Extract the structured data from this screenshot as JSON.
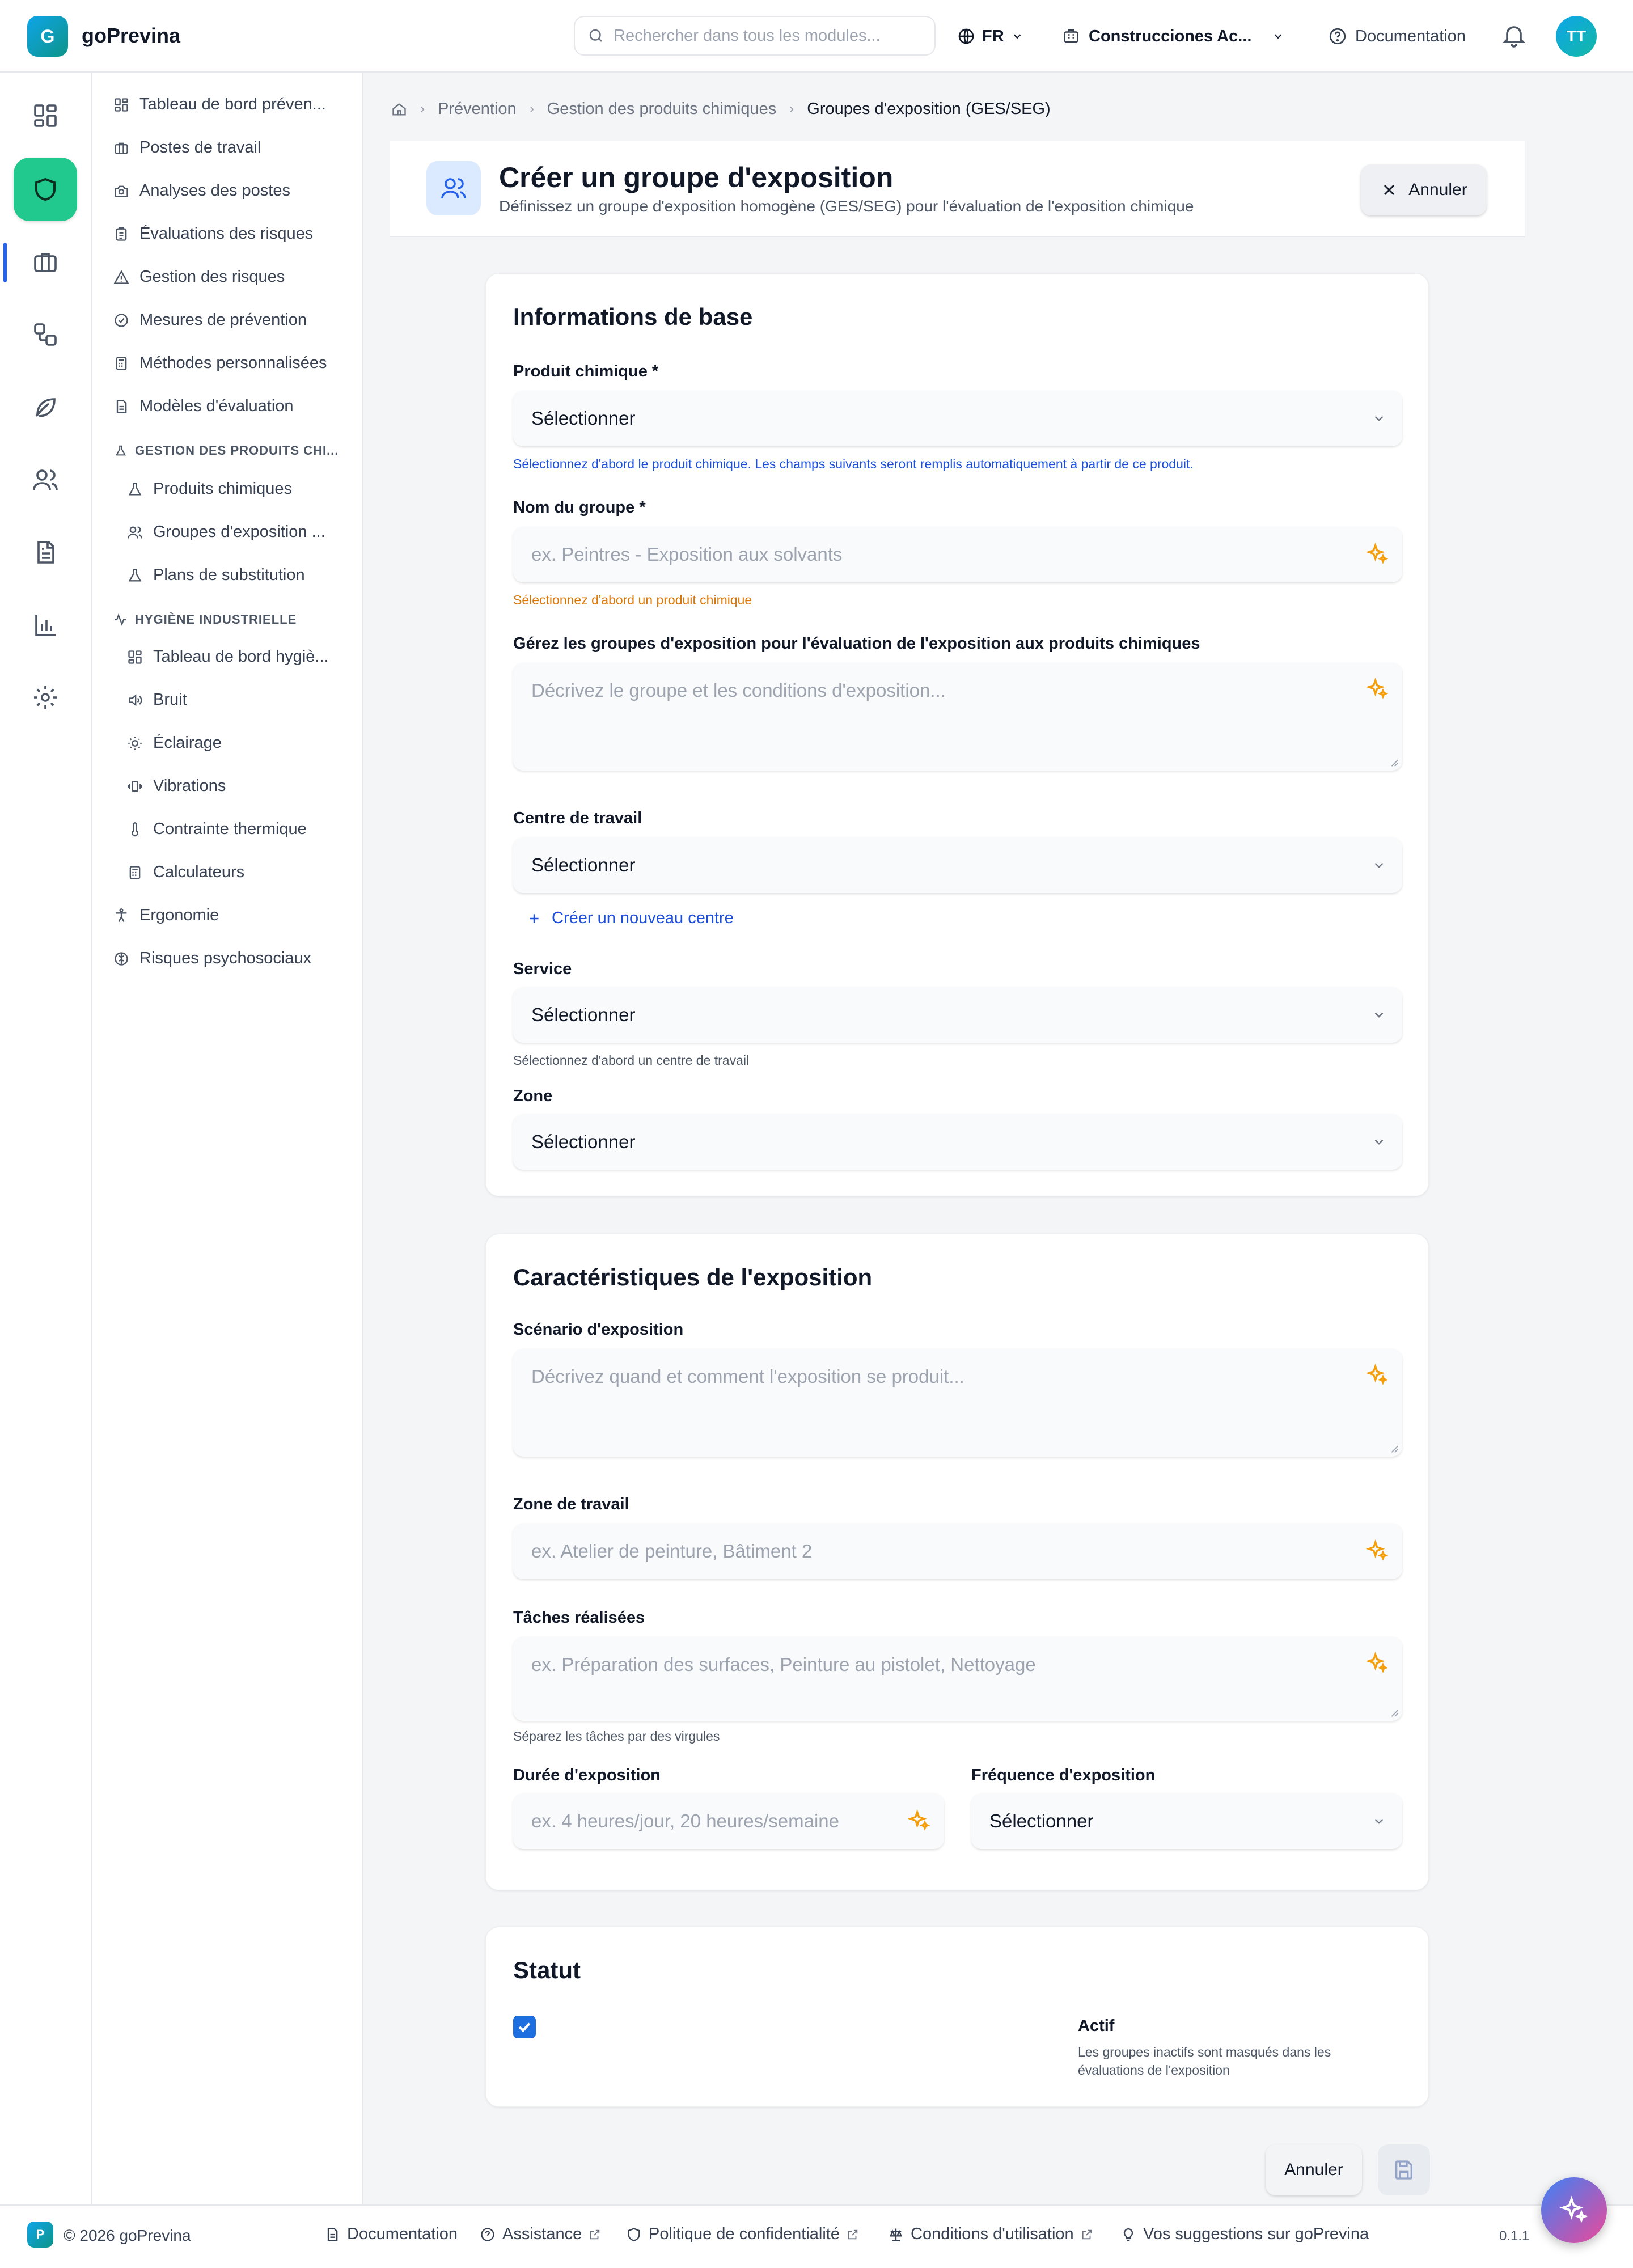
{
  "app": {
    "logo_letter": "G",
    "name": "goPrevina"
  },
  "topbar": {
    "search_placeholder": "Rechercher dans tous les modules...",
    "language": "FR",
    "company": "Construcciones Ac...",
    "documentation": "Documentation",
    "avatar_initials": "TT"
  },
  "rail": {
    "items": [
      {
        "icon": "dashboard-icon"
      },
      {
        "icon": "shield-icon",
        "active": true
      },
      {
        "icon": "briefcase-icon"
      },
      {
        "icon": "workflow-icon"
      },
      {
        "icon": "leaf-icon"
      },
      {
        "icon": "users-icon"
      },
      {
        "icon": "document-icon"
      },
      {
        "icon": "bar-chart-icon"
      },
      {
        "icon": "settings-icon"
      }
    ]
  },
  "sidenav": {
    "items": [
      {
        "label": "Tableau de bord préven...",
        "icon": "dashboard-icon"
      },
      {
        "label": "Postes de travail",
        "icon": "briefcase-icon"
      },
      {
        "label": "Analyses des postes",
        "icon": "camera-icon"
      },
      {
        "label": "Évaluations des risques",
        "icon": "clipboard-icon"
      },
      {
        "label": "Gestion des risques",
        "icon": "warning-icon"
      },
      {
        "label": "Mesures de prévention",
        "icon": "check-circle-icon"
      },
      {
        "label": "Méthodes personnalisées",
        "icon": "calculator-icon"
      },
      {
        "label": "Modèles d'évaluation",
        "icon": "file-icon"
      }
    ],
    "section_chem": {
      "title": "Gestion des produits chi...",
      "items": [
        {
          "label": "Produits chimiques",
          "icon": "flask-icon"
        },
        {
          "label": "Groupes d'exposition ...",
          "icon": "users-icon"
        },
        {
          "label": "Plans de substitution",
          "icon": "flask-icon"
        }
      ]
    },
    "section_hyg": {
      "title": "Hygiène industrielle",
      "items": [
        {
          "label": "Tableau de bord hygiè...",
          "icon": "dashboard-icon"
        },
        {
          "label": "Bruit",
          "icon": "speaker-icon"
        },
        {
          "label": "Éclairage",
          "icon": "sun-icon"
        },
        {
          "label": "Vibrations",
          "icon": "vibration-icon"
        },
        {
          "label": "Contrainte thermique",
          "icon": "thermometer-icon"
        },
        {
          "label": "Calculateurs",
          "icon": "calculator-icon"
        }
      ]
    },
    "bottom": [
      {
        "label": "Ergonomie",
        "icon": "person-icon"
      },
      {
        "label": "Risques psychosociaux",
        "icon": "brain-icon"
      }
    ]
  },
  "breadcrumb": [
    "Prévention",
    "Gestion des produits chimiques",
    "Groupes d'exposition (GES/SEG)"
  ],
  "header": {
    "title": "Créer un groupe d'exposition",
    "subtitle": "Définissez un groupe d'exposition homogène (GES/SEG) pour l'évaluation de l'exposition chimique",
    "cancel": "Annuler"
  },
  "basic": {
    "title": "Informations de base",
    "product_label": "Produit chimique *",
    "product_value": "Sélectionner",
    "product_hint": "Sélectionnez d'abord le produit chimique. Les champs suivants seront remplis automatiquement à partir de ce produit.",
    "group_label": "Nom du groupe *",
    "group_placeholder": "ex. Peintres - Exposition aux solvants",
    "group_hint": "Sélectionnez d'abord un produit chimique",
    "desc_label": "Gérez les groupes d'exposition pour l'évaluation de l'exposition aux produits chimiques",
    "desc_placeholder": "Décrivez le groupe et les conditions d'exposition...",
    "center_label": "Centre de travail",
    "center_value": "Sélectionner",
    "new_center": "Créer un nouveau centre",
    "service_label": "Service",
    "service_value": "Sélectionner",
    "service_hint": "Sélectionnez d'abord un centre de travail",
    "zone_label": "Zone",
    "zone_value": "Sélectionner"
  },
  "exposure": {
    "title": "Caractéristiques de l'exposition",
    "scenario_label": "Scénario d'exposition",
    "scenario_placeholder": "Décrivez quand et comment l'exposition se produit...",
    "workzone_label": "Zone de travail",
    "workzone_placeholder": "ex. Atelier de peinture, Bâtiment 2",
    "tasks_label": "Tâches réalisées",
    "tasks_placeholder": "ex. Préparation des surfaces, Peinture au pistolet, Nettoyage",
    "tasks_hint": "Séparez les tâches par des virgules",
    "duration_label": "Durée d'exposition",
    "duration_placeholder": "ex. 4 heures/jour, 20 heures/semaine",
    "frequency_label": "Fréquence d'exposition",
    "frequency_value": "Sélectionner"
  },
  "status": {
    "title": "Statut",
    "checked": true,
    "label": "Actif",
    "desc": "Les groupes inactifs sont masqués dans les évaluations de l'exposition"
  },
  "actions": {
    "cancel": "Annuler"
  },
  "footer": {
    "logo_letter": "P",
    "copyright": "© 2026 goPrevina",
    "links": [
      "Documentation",
      "Assistance",
      "Politique de confidentialité",
      "Conditions d'utilisation",
      "Vos suggestions sur goPrevina"
    ],
    "version": "0.1.1"
  },
  "colors": {
    "accent": "#22c98e",
    "primary": "#1d4ed8",
    "sparkle": "#f59e0b",
    "warning": "#d97706"
  }
}
